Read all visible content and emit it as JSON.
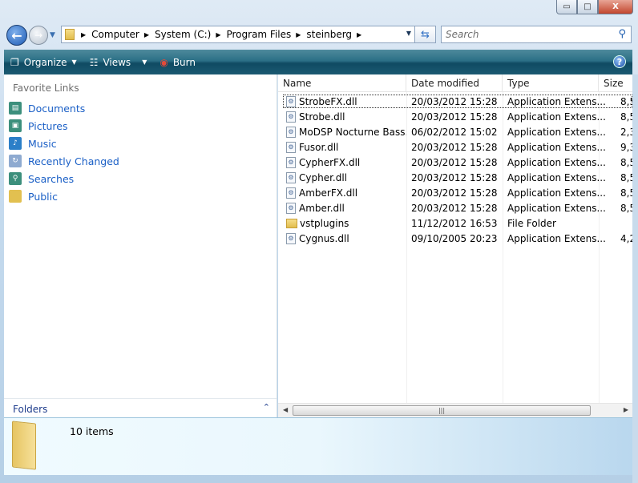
{
  "window": {
    "controls": {
      "minimize": "▭",
      "maximize": "□",
      "close": "X"
    }
  },
  "nav": {
    "back_icon": "←",
    "forward_icon": "→"
  },
  "address": {
    "crumbs": [
      "Computer",
      "System (C:)",
      "Program Files",
      "steinberg"
    ]
  },
  "search": {
    "placeholder": "Search"
  },
  "toolbar": {
    "organize": "Organize",
    "views": "Views",
    "burn": "Burn",
    "help": "?"
  },
  "sidebar": {
    "heading": "Favorite Links",
    "items": [
      {
        "label": "Documents",
        "color": "#3c8f7c"
      },
      {
        "label": "Pictures",
        "color": "#3c8f7c"
      },
      {
        "label": "Music",
        "color": "#2c7fc8"
      },
      {
        "label": "Recently Changed",
        "color": "#8eaad0"
      },
      {
        "label": "Searches",
        "color": "#3c8f7c"
      },
      {
        "label": "Public",
        "color": "#e2c050"
      }
    ],
    "folders": "Folders"
  },
  "list": {
    "columns": [
      "Name",
      "Date modified",
      "Type",
      "Size"
    ],
    "rows": [
      {
        "name": "StrobeFX.dll",
        "date": "20/03/2012 15:28",
        "type": "Application Extens...",
        "size": "8,5",
        "icon": "dll"
      },
      {
        "name": "Strobe.dll",
        "date": "20/03/2012 15:28",
        "type": "Application Extens...",
        "size": "8,5",
        "icon": "dll"
      },
      {
        "name": "MoDSP Nocturne Bass....",
        "date": "06/02/2012 15:02",
        "type": "Application Extens...",
        "size": "2,3",
        "icon": "dll"
      },
      {
        "name": "Fusor.dll",
        "date": "20/03/2012 15:28",
        "type": "Application Extens...",
        "size": "9,3",
        "icon": "dll"
      },
      {
        "name": "CypherFX.dll",
        "date": "20/03/2012 15:28",
        "type": "Application Extens...",
        "size": "8,5",
        "icon": "dll"
      },
      {
        "name": "Cypher.dll",
        "date": "20/03/2012 15:28",
        "type": "Application Extens...",
        "size": "8,5",
        "icon": "dll"
      },
      {
        "name": "AmberFX.dll",
        "date": "20/03/2012 15:28",
        "type": "Application Extens...",
        "size": "8,5",
        "icon": "dll"
      },
      {
        "name": "Amber.dll",
        "date": "20/03/2012 15:28",
        "type": "Application Extens...",
        "size": "8,5",
        "icon": "dll"
      },
      {
        "name": "vstplugins",
        "date": "11/12/2012 16:53",
        "type": "File Folder",
        "size": "",
        "icon": "folder"
      },
      {
        "name": "Cygnus.dll",
        "date": "09/10/2005 20:23",
        "type": "Application Extens...",
        "size": "4,2",
        "icon": "dll"
      }
    ]
  },
  "details": {
    "count": "10 items"
  }
}
